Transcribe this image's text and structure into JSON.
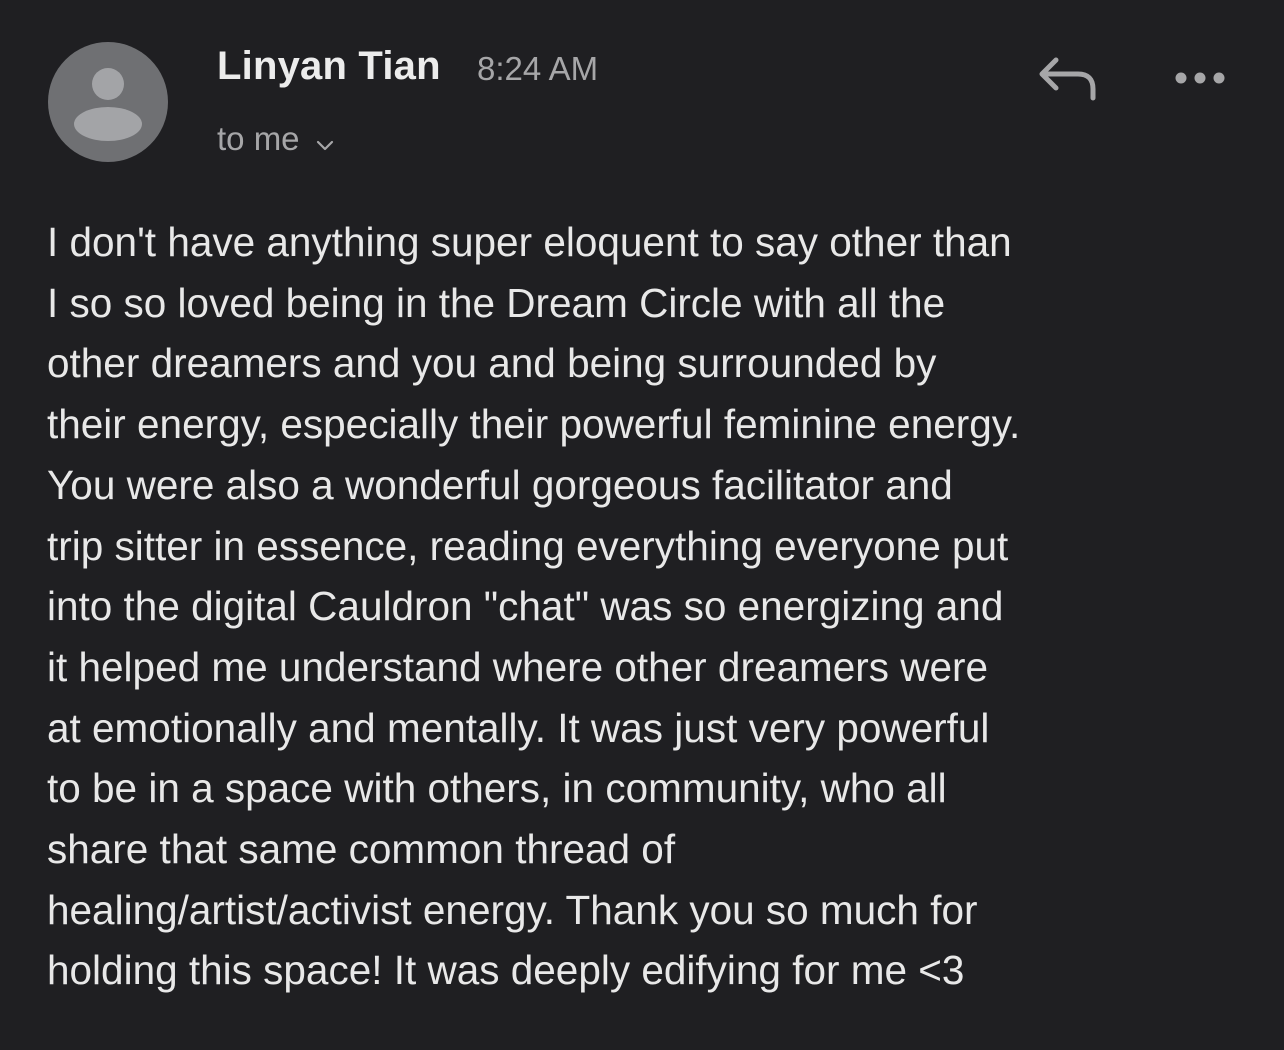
{
  "header": {
    "sender_name": "Linyan Tian",
    "timestamp": "8:24 AM",
    "recipient_label": "to me",
    "avatar_icon": "person-placeholder-icon",
    "reply_icon": "reply-icon",
    "more_icon": "more-options-icon"
  },
  "colors": {
    "background": "#1f1f22",
    "avatar": "#6f7073",
    "text_primary": "#e8e8e8",
    "text_secondary": "#a6a6a8"
  },
  "body": {
    "lines": [
      "I don't have anything super eloquent to say other than",
      "I so so loved being in the Dream Circle with all the",
      "other dreamers and you and being surrounded by",
      "their energy, especially their powerful feminine energy.",
      "You were also a wonderful gorgeous facilitator and",
      "trip sitter in essence, reading everything everyone put",
      "into the digital Cauldron \"chat\" was so energizing and",
      "it helped me understand where other dreamers were",
      "at emotionally and mentally. It was just very powerful",
      "to be in a space with others, in community, who all",
      "share that same common thread of",
      "healing/artist/activist energy. Thank you so much for",
      "holding this space! It was deeply edifying for me <3"
    ]
  }
}
